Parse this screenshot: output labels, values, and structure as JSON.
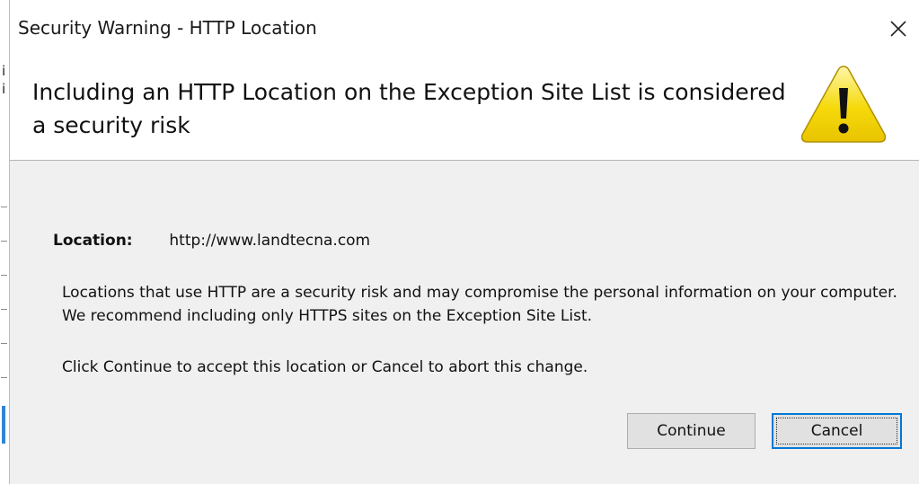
{
  "window": {
    "title": "Security Warning - HTTP Location",
    "close_icon": "close-icon"
  },
  "background_strip": {
    "char_top": "i",
    "char_second": "i"
  },
  "header": {
    "title": "Including an HTTP Location on the Exception Site List is considered a security risk",
    "icon": "warning-icon",
    "icon_color": "#f5d90a"
  },
  "body": {
    "location_label": "Location:",
    "location_value": "http://www.landtecna.com",
    "paragraph1": "Locations that use HTTP are a security risk and may compromise the personal information on your computer.  We recommend including only HTTPS sites on the Exception Site List.",
    "paragraph2": "Click Continue to accept this location or Cancel to abort this change."
  },
  "buttons": {
    "continue_label": "Continue",
    "cancel_label": "Cancel"
  },
  "colors": {
    "dialog_bg": "#f0f0f0",
    "focus_accent": "#0078d7"
  }
}
